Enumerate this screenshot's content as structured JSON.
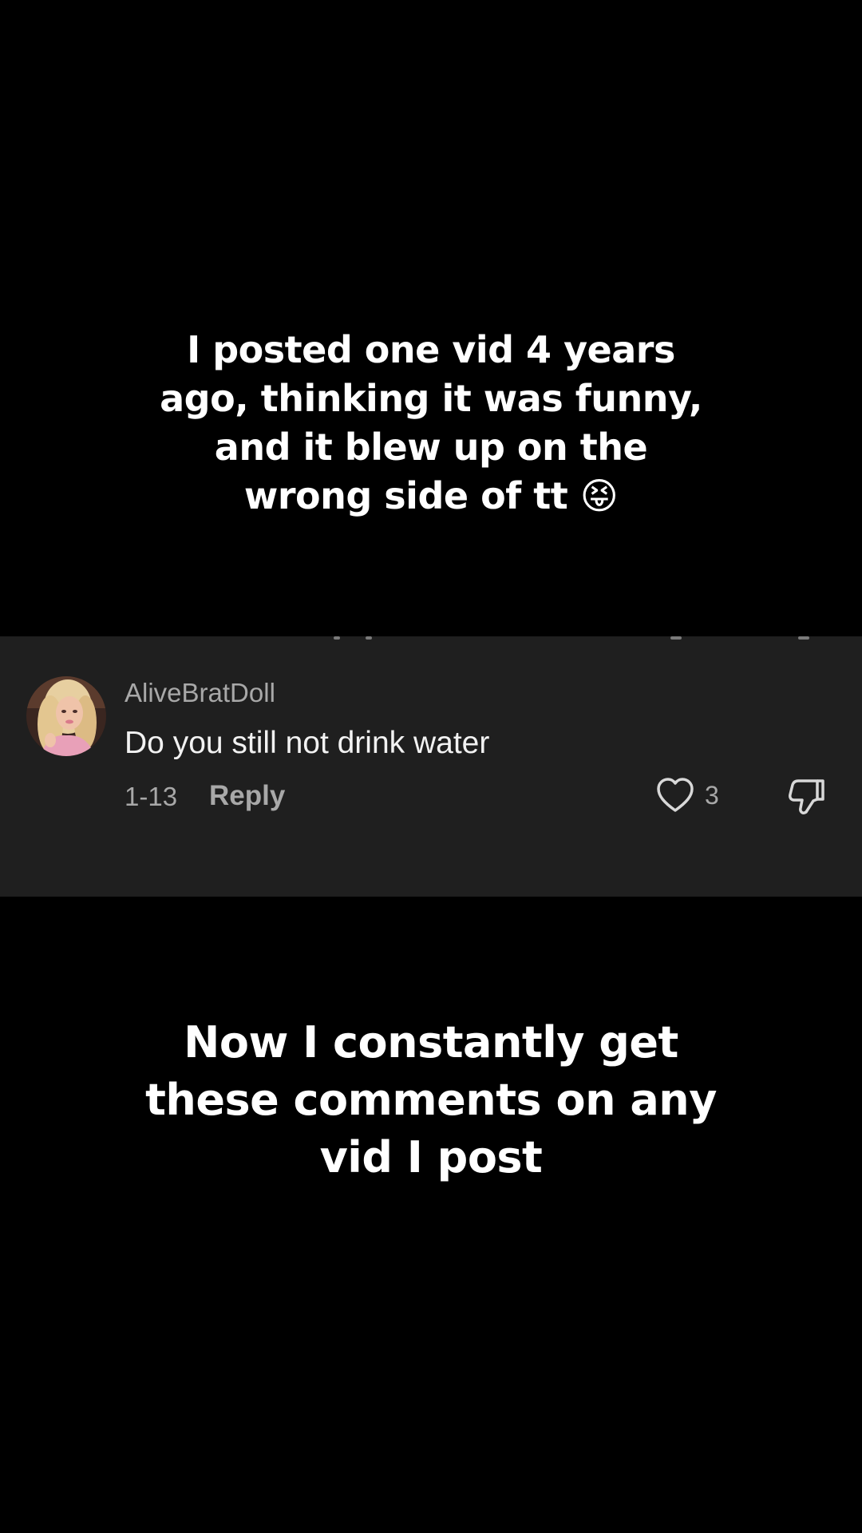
{
  "caption_top": {
    "lines": [
      "I posted one vid 4 years",
      "ago, thinking it was funny,",
      "and it blew up on the",
      "wrong side of tt 😝"
    ]
  },
  "comment": {
    "username": "AliveBratDoll",
    "text": "Do you still not drink water",
    "date": "1-13",
    "reply_label": "Reply",
    "like_count": "3",
    "icons": {
      "like": "heart-icon",
      "dislike": "thumbs-down-icon"
    }
  },
  "caption_bottom": {
    "lines": [
      "Now I constantly get",
      "these comments on any",
      "vid I post"
    ]
  },
  "colors": {
    "background": "#000000",
    "card": "#1f1f1f",
    "muted_text": "#a8a8a8",
    "primary_text": "#f2f2f2"
  }
}
